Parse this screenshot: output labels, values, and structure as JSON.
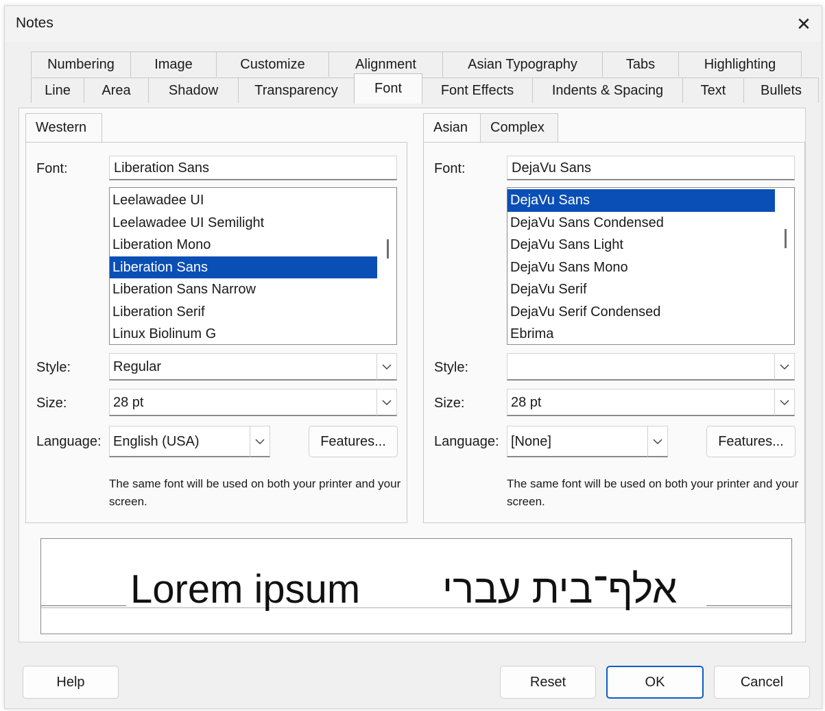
{
  "window": {
    "title": "Notes"
  },
  "tabs_row1": [
    "Numbering",
    "Image",
    "Customize",
    "Alignment",
    "Asian Typography",
    "Tabs",
    "Highlighting"
  ],
  "tabs_row2": [
    "Line",
    "Area",
    "Shadow",
    "Transparency",
    "Font",
    "Font Effects",
    "Indents & Spacing",
    "Text",
    "Bullets"
  ],
  "active_tab": "Font",
  "western": {
    "tab_label": "Western",
    "font_label": "Font:",
    "font_value": "Liberation Sans",
    "font_list": [
      "Leelawadee UI",
      "Leelawadee UI Semilight",
      "Liberation Mono",
      "Liberation Sans",
      "Liberation Sans Narrow",
      "Liberation Serif",
      "Linux Biolinum G"
    ],
    "selected_font": "Liberation Sans",
    "style_label": "Style:",
    "style_value": "Regular",
    "size_label": "Size:",
    "size_value": "28 pt",
    "language_label": "Language:",
    "language_value": "English (USA)",
    "features_label": "Features...",
    "note": "The same font will be used on both your printer and your screen."
  },
  "asian": {
    "tab_label": "Asian",
    "complex_tab_label": "Complex",
    "font_label": "Font:",
    "font_value": "DejaVu Sans",
    "font_list": [
      "DejaVu Sans",
      "DejaVu Sans Condensed",
      "DejaVu Sans Light",
      "DejaVu Sans Mono",
      "DejaVu Serif",
      "DejaVu Serif Condensed",
      "Ebrima"
    ],
    "selected_font": "DejaVu Sans",
    "style_label": "Style:",
    "style_value": "",
    "size_label": "Size:",
    "size_value": "28 pt",
    "language_label": "Language:",
    "language_value": "[None]",
    "features_label": "Features...",
    "note": "The same font will be used on both your printer and your screen."
  },
  "preview": {
    "latin_text": "Lorem ipsum",
    "hebrew_text": "אלף־בית עברי"
  },
  "buttons": {
    "help": "Help",
    "reset": "Reset",
    "ok": "OK",
    "cancel": "Cancel"
  },
  "colors": {
    "selection": "#0a4fb5",
    "dialog_bg": "#f0f0f0",
    "page_bg": "#fafafa",
    "ok_border": "#0a5cc5"
  }
}
